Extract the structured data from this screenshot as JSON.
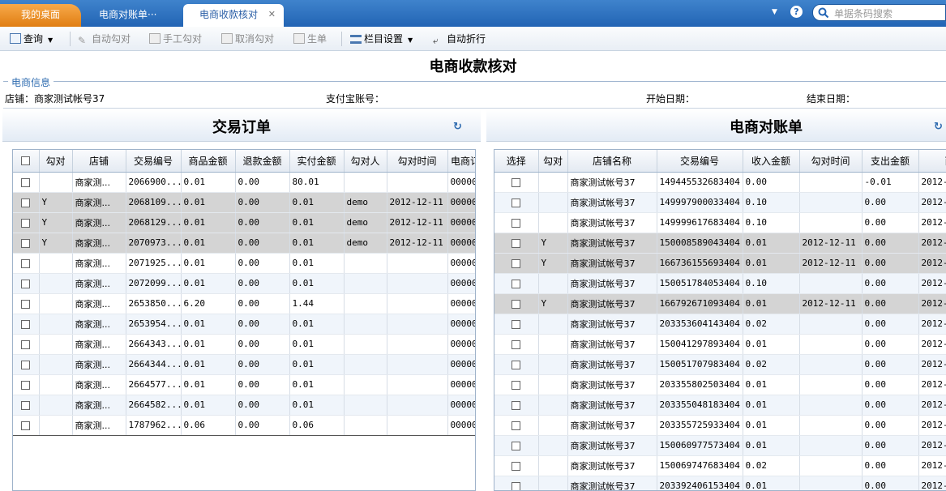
{
  "tabs": [
    {
      "label": "我的桌面"
    },
    {
      "label": "电商对账单···"
    },
    {
      "label": "电商收款核对"
    }
  ],
  "search": {
    "placeholder": "单据条码搜索"
  },
  "toolbar": {
    "query": "查询",
    "auto_check": "自动勾对",
    "manual_check": "手工勾对",
    "cancel_check": "取消勾对",
    "generate": "生单",
    "column_settings": "栏目设置",
    "auto_wrap": "自动折行"
  },
  "page_title": "电商收款核对",
  "info": {
    "legend": "电商信息",
    "store_label": "店铺：",
    "store_value": "商家测试帐号37",
    "alipay_label": "支付宝账号：",
    "start_label": "开始日期：",
    "end_label": "结束日期："
  },
  "left": {
    "title": "交易订单",
    "headers": [
      "勾对",
      "店铺",
      "交易编号",
      "商品金额",
      "退款金额",
      "实付金额",
      "勾对人",
      "勾对时间",
      "电商订"
    ],
    "rows": [
      [
        "",
        "商家测...",
        "2066900...",
        "0.01",
        "0.00",
        "80.01",
        "",
        "",
        "00000"
      ],
      [
        "Y",
        "商家测...",
        "2068109...",
        "0.01",
        "0.00",
        "0.01",
        "demo",
        "2012-12-11",
        "00000"
      ],
      [
        "Y",
        "商家测...",
        "2068129...",
        "0.01",
        "0.00",
        "0.01",
        "demo",
        "2012-12-11",
        "00000"
      ],
      [
        "Y",
        "商家测...",
        "2070973...",
        "0.01",
        "0.00",
        "0.01",
        "demo",
        "2012-12-11",
        "00000"
      ],
      [
        "",
        "商家测...",
        "2071925...",
        "0.01",
        "0.00",
        "0.01",
        "",
        "",
        "00000"
      ],
      [
        "",
        "商家测...",
        "2072099...",
        "0.01",
        "0.00",
        "0.01",
        "",
        "",
        "00000"
      ],
      [
        "",
        "商家测...",
        "2653850...",
        "6.20",
        "0.00",
        "1.44",
        "",
        "",
        "00000"
      ],
      [
        "",
        "商家测...",
        "2653954...",
        "0.01",
        "0.00",
        "0.01",
        "",
        "",
        "00000"
      ],
      [
        "",
        "商家测...",
        "2664343...",
        "0.01",
        "0.00",
        "0.01",
        "",
        "",
        "00000"
      ],
      [
        "",
        "商家测...",
        "2664344...",
        "0.01",
        "0.00",
        "0.01",
        "",
        "",
        "00000"
      ],
      [
        "",
        "商家测...",
        "2664577...",
        "0.01",
        "0.00",
        "0.01",
        "",
        "",
        "00000"
      ],
      [
        "",
        "商家测...",
        "2664582...",
        "0.01",
        "0.00",
        "0.01",
        "",
        "",
        "00000"
      ],
      [
        "",
        "商家测...",
        "1787962...",
        "0.06",
        "0.00",
        "0.06",
        "",
        "",
        "00000"
      ]
    ]
  },
  "right": {
    "title": "电商对账单",
    "headers": [
      "选择",
      "勾对",
      "店铺名称",
      "交易编号",
      "收入金额",
      "勾对时间",
      "支出金额",
      "西"
    ],
    "rows": [
      [
        "",
        "商家测试帐号37",
        "149445532683404",
        "0.00",
        "",
        "-0.01",
        "2012-"
      ],
      [
        "",
        "商家测试帐号37",
        "149997900033404",
        "0.10",
        "",
        "0.00",
        "2012-"
      ],
      [
        "",
        "商家测试帐号37",
        "149999617683404",
        "0.10",
        "",
        "0.00",
        "2012-"
      ],
      [
        "Y",
        "商家测试帐号37",
        "150008589043404",
        "0.01",
        "2012-12-11",
        "0.00",
        "2012-"
      ],
      [
        "Y",
        "商家测试帐号37",
        "166736155693404",
        "0.01",
        "2012-12-11",
        "0.00",
        "2012-"
      ],
      [
        "",
        "商家测试帐号37",
        "150051784053404",
        "0.10",
        "",
        "0.00",
        "2012-"
      ],
      [
        "Y",
        "商家测试帐号37",
        "166792671093404",
        "0.01",
        "2012-12-11",
        "0.00",
        "2012-"
      ],
      [
        "",
        "商家测试帐号37",
        "203353604143404",
        "0.02",
        "",
        "0.00",
        "2012-"
      ],
      [
        "",
        "商家测试帐号37",
        "150041297893404",
        "0.01",
        "",
        "0.00",
        "2012-"
      ],
      [
        "",
        "商家测试帐号37",
        "150051707983404",
        "0.02",
        "",
        "0.00",
        "2012-"
      ],
      [
        "",
        "商家测试帐号37",
        "203355802503404",
        "0.01",
        "",
        "0.00",
        "2012-"
      ],
      [
        "",
        "商家测试帐号37",
        "203355048183404",
        "0.01",
        "",
        "0.00",
        "2012-"
      ],
      [
        "",
        "商家测试帐号37",
        "203355725933404",
        "0.01",
        "",
        "0.00",
        "2012-"
      ],
      [
        "",
        "商家测试帐号37",
        "150060977573404",
        "0.01",
        "",
        "0.00",
        "2012-"
      ],
      [
        "",
        "商家测试帐号37",
        "150069747683404",
        "0.02",
        "",
        "0.00",
        "2012-"
      ],
      [
        "",
        "商家测试帐号37",
        "203392406153404",
        "0.01",
        "",
        "0.00",
        "2012-"
      ]
    ]
  }
}
